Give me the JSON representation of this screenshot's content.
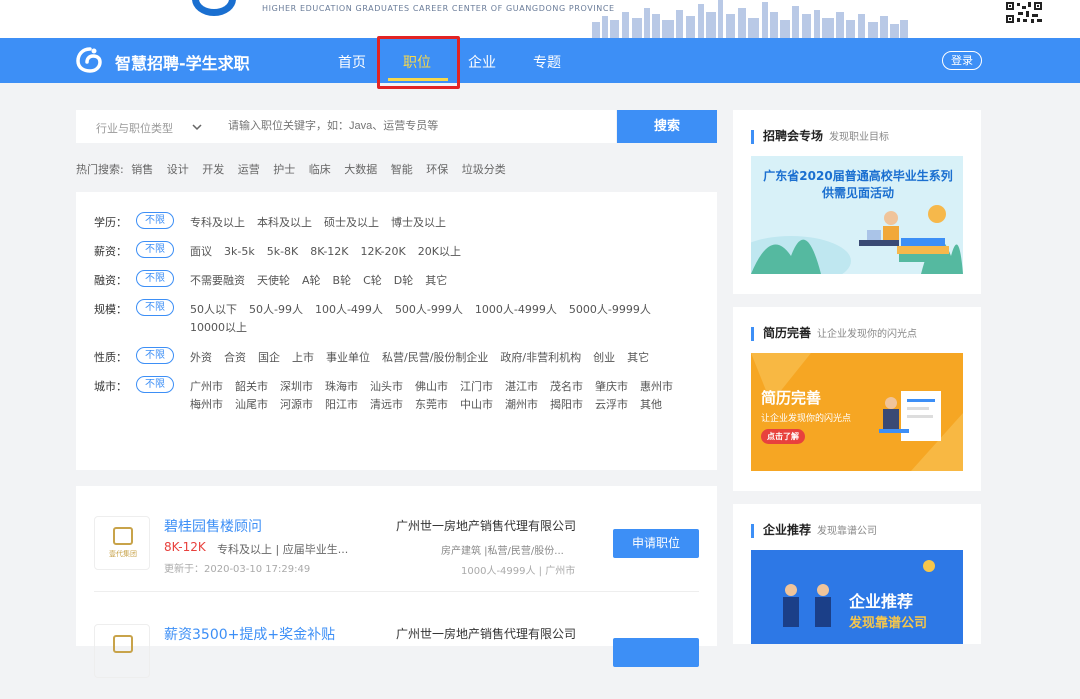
{
  "header": {
    "org_english": "HIGHER EDUCATION GRADUATES CAREER CENTER OF GUANGDONG PROVINCE"
  },
  "nav": {
    "brand": "智慧招聘-学生求职",
    "items": [
      {
        "label": "首页",
        "active": false
      },
      {
        "label": "职位",
        "active": true
      },
      {
        "label": "企业",
        "active": false
      },
      {
        "label": "专题",
        "active": false
      }
    ],
    "login": "登录",
    "accent": "#3d8ff6",
    "active_color": "#f7d84a"
  },
  "search": {
    "type_label": "行业与职位类型",
    "placeholder": "请输入职位关键字，如：Java、运营专员等",
    "button": "搜索",
    "hot_label": "热门搜索:",
    "hot_terms": [
      "销售",
      "设计",
      "开发",
      "运营",
      "护士",
      "临床",
      "大数据",
      "智能",
      "环保",
      "垃圾分类"
    ]
  },
  "filters": {
    "any_label": "不限",
    "rows": [
      {
        "label": "学历：",
        "options": [
          "专科及以上",
          "本科及以上",
          "硕士及以上",
          "博士及以上"
        ]
      },
      {
        "label": "薪资：",
        "options": [
          "面议",
          "3k-5k",
          "5k-8K",
          "8K-12K",
          "12K-20K",
          "20K以上"
        ]
      },
      {
        "label": "融资：",
        "options": [
          "不需要融资",
          "天使轮",
          "A轮",
          "B轮",
          "C轮",
          "D轮",
          "其它"
        ]
      },
      {
        "label": "规模：",
        "options": [
          "50人以下",
          "50人-99人",
          "100人-499人",
          "500人-999人",
          "1000人-4999人",
          "5000人-9999人",
          "10000以上"
        ]
      },
      {
        "label": "性质：",
        "options": [
          "外资",
          "合资",
          "国企",
          "上市",
          "事业单位",
          "私营/民营/股份制企业",
          "政府/非营利机构",
          "创业",
          "其它"
        ]
      },
      {
        "label": "城市：",
        "options": [
          "广州市",
          "韶关市",
          "深圳市",
          "珠海市",
          "汕头市",
          "佛山市",
          "江门市",
          "湛江市",
          "茂名市",
          "肇庆市",
          "惠州市",
          "梅州市",
          "汕尾市",
          "河源市",
          "阳江市",
          "清远市",
          "东莞市",
          "中山市",
          "潮州市",
          "揭阳市",
          "云浮市",
          "其他"
        ]
      }
    ]
  },
  "jobs": [
    {
      "title": "碧桂园售楼顾问",
      "salary": "8K-12K",
      "meta": "专科及以上 | 应届毕业生...",
      "updated": "更新于：2020-03-10 17:29:49",
      "company": "广州世一房地产销售代理有限公司",
      "industry": "房产建筑 |私营/民营/股份...",
      "size": "1000人-4999人 | 广州市",
      "apply": "申请职位",
      "logo_text": "壹代集团"
    },
    {
      "title": "薪资3500+提成+奖金补贴",
      "company": "广州世一房地产销售代理有限公司"
    }
  ],
  "sidebar": [
    {
      "title": "招聘会专场",
      "subtitle": "发现职业目标",
      "promo_text": "广东省2020届普通高校毕业生系列供需见面活动"
    },
    {
      "title": "简历完善",
      "subtitle": "让企业发现你的闪光点",
      "promo_title": "简历完善",
      "promo_sub": "让企业发现你的闪光点",
      "promo_btn": "点击了解"
    },
    {
      "title": "企业推荐",
      "subtitle": "发现靠谱公司",
      "promo_title": "企业推荐",
      "promo_sub": "发现靠谱公司"
    }
  ]
}
